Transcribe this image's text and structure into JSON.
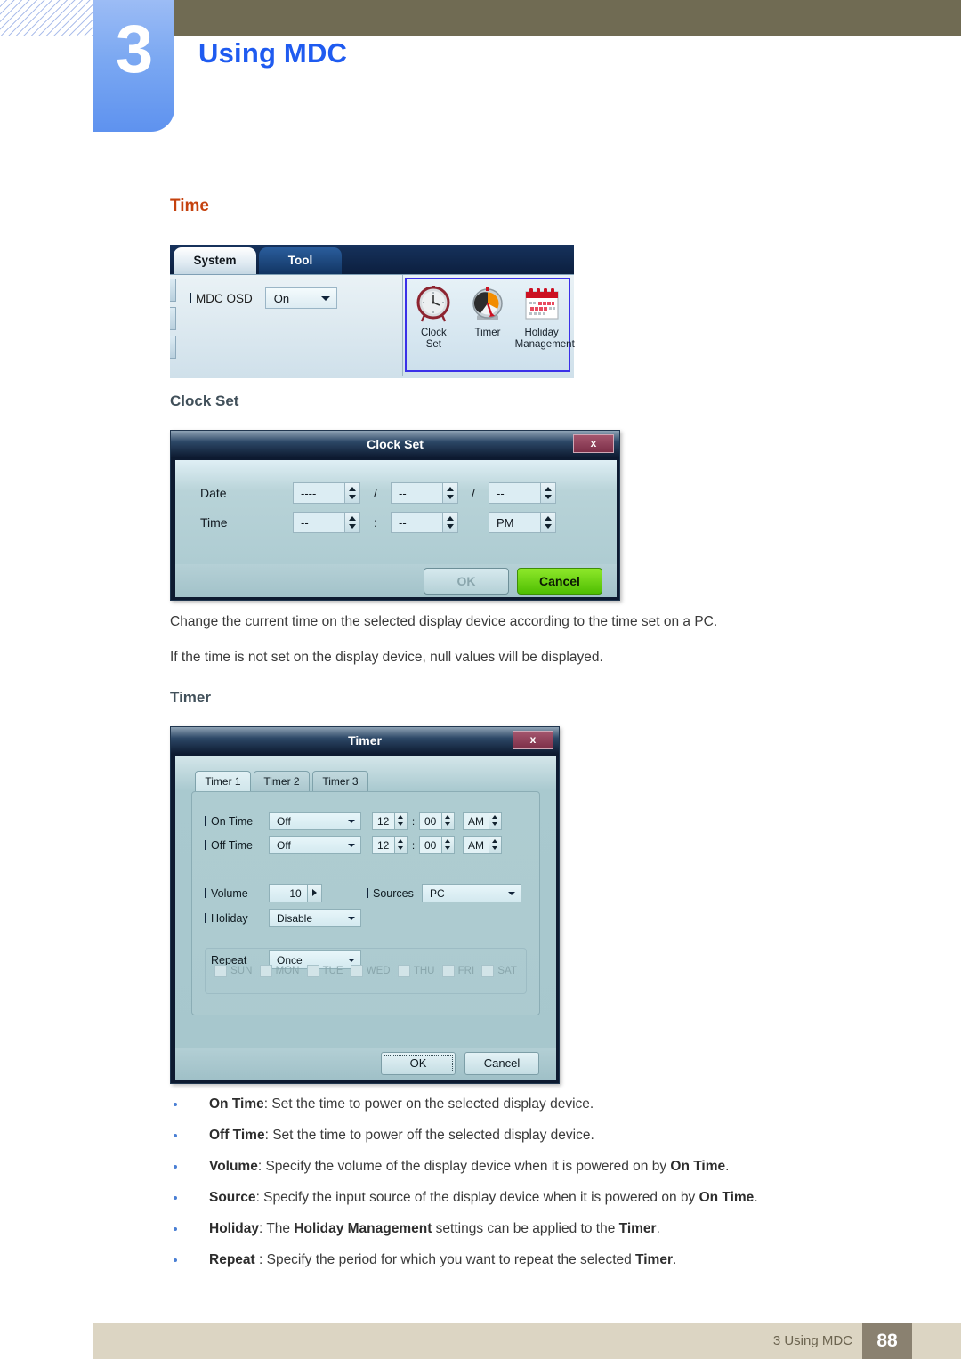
{
  "header": {
    "chapter_number": "3",
    "chapter_title": "Using MDC"
  },
  "section": {
    "title": "Time",
    "clock_set_heading": "Clock Set",
    "timer_heading": "Timer"
  },
  "system_panel": {
    "tabs": [
      {
        "label": "System",
        "active": true
      },
      {
        "label": "Tool",
        "active": false
      }
    ],
    "osd": {
      "label": "MDC OSD",
      "value": "On"
    },
    "icons": [
      {
        "name": "clock-set-icon",
        "caption_line1": "Clock",
        "caption_line2": "Set"
      },
      {
        "name": "timer-icon",
        "caption_line1": "Timer",
        "caption_line2": ""
      },
      {
        "name": "holiday-management-icon",
        "caption_line1": "Holiday",
        "caption_line2": "Management"
      }
    ],
    "highlight_color": "#3a30e8"
  },
  "clock_set_dialog": {
    "title": "Clock Set",
    "close_label": "x",
    "date_label": "Date",
    "time_label": "Time",
    "date_year": "----",
    "date_month": "--",
    "date_day": "--",
    "date_sep1": "/",
    "date_sep2": "/",
    "time_hour": "--",
    "time_minute": "--",
    "time_meridiem": "PM",
    "time_sep": ":",
    "ok_label": "OK",
    "cancel_label": "Cancel",
    "ok_enabled": false,
    "cancel_color": "#6ed01a"
  },
  "timer_dialog": {
    "title": "Timer",
    "close_label": "x",
    "tabs": [
      {
        "label": "Timer 1",
        "active": true
      },
      {
        "label": "Timer 2",
        "active": false
      },
      {
        "label": "Timer 3",
        "active": false
      }
    ],
    "on_time": {
      "label": "On Time",
      "state": "Off",
      "hour": "12",
      "minute": "00",
      "meridiem": "AM",
      "colon": ":"
    },
    "off_time": {
      "label": "Off Time",
      "state": "Off",
      "hour": "12",
      "minute": "00",
      "meridiem": "AM",
      "colon": ":"
    },
    "volume": {
      "label": "Volume",
      "value": "10"
    },
    "sources": {
      "label": "Sources",
      "value": "PC"
    },
    "holiday": {
      "label": "Holiday",
      "value": "Disable"
    },
    "repeat": {
      "label": "Repeat",
      "value": "Once"
    },
    "days": [
      {
        "label": "SUN",
        "checked": false
      },
      {
        "label": "MON",
        "checked": false
      },
      {
        "label": "TUE",
        "checked": false
      },
      {
        "label": "WED",
        "checked": false
      },
      {
        "label": "THU",
        "checked": false
      },
      {
        "label": "FRI",
        "checked": false
      },
      {
        "label": "SAT",
        "checked": false
      }
    ],
    "ok_label": "OK",
    "cancel_label": "Cancel"
  },
  "paragraphs": {
    "p1": "Change the current time on the selected display device according to the time set on a PC.",
    "p2": "If the time is not set on the display device, null values will be displayed."
  },
  "bullets": [
    {
      "term": "On Time",
      "rest": ": Set the time to power on the selected display device."
    },
    {
      "term": "Off Time",
      "rest": ": Set the time to power off the selected display device."
    },
    {
      "term": "Volume",
      "rest": ": Specify the volume of the display device when it is powered on by ",
      "term2": "On Time",
      "tail": "."
    },
    {
      "term": "Source",
      "rest": ": Specify the input source of the display device when it is powered on by ",
      "term2": "On Time",
      "tail": "."
    },
    {
      "term": "Holiday",
      "rest": ": The ",
      "term2": "Holiday Management",
      "mid": " settings can be applied to the ",
      "term3": "Timer",
      "tail": "."
    },
    {
      "term": "Repeat",
      "rest": " : Specify the period for which you want to repeat the selected ",
      "term2": "Timer",
      "tail": "."
    }
  ],
  "footer": {
    "text": "3 Using MDC",
    "page": "88"
  }
}
